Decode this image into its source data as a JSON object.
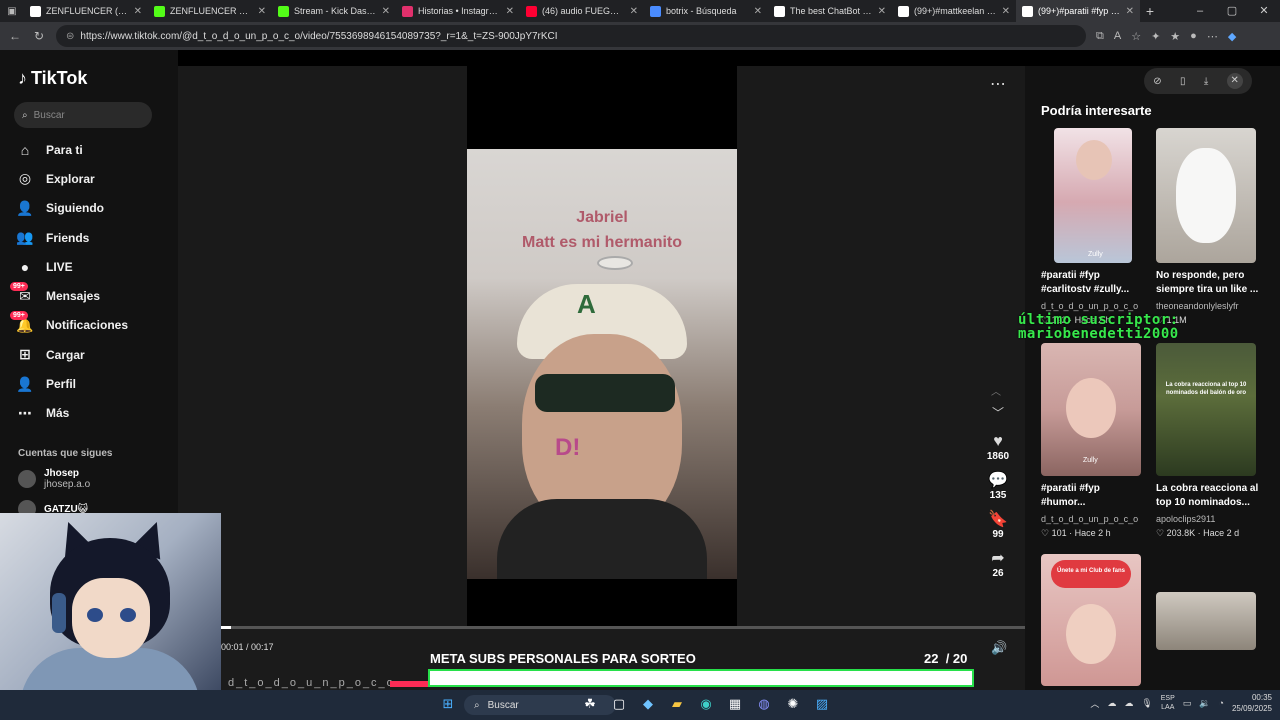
{
  "browser": {
    "tabs": [
      {
        "title": "ZENFLUENCER (@zenfl",
        "color": "#ffffff",
        "active": false
      },
      {
        "title": "ZENFLUENCER Stream",
        "color": "#53fc18",
        "active": false
      },
      {
        "title": "Stream - Kick Dashbo",
        "color": "#53fc18",
        "active": false
      },
      {
        "title": "Historias • Instagram",
        "color": "#e1306c",
        "active": false
      },
      {
        "title": "(46) audio FUEGO, FUE",
        "color": "#ff0033",
        "active": false
      },
      {
        "title": "botrix - Búsqueda",
        "color": "#4a8cff",
        "active": false
      },
      {
        "title": "The best ChatBot and V",
        "color": "#ffffff",
        "active": false
      },
      {
        "title": "(99+)#mattkeelan #ma",
        "color": "#ffffff",
        "active": false
      },
      {
        "title": "(99+)#paratii #fyp #hu",
        "color": "#ffffff",
        "active": true
      }
    ],
    "url": "https://www.tiktok.com/@d_t_o_d_o_un_p_o_c_o/video/7553698946154089735?_r=1&_t=ZS-900JpY7rKCI"
  },
  "sidebar": {
    "logo": "TikTok",
    "search_placeholder": "Buscar",
    "nav": [
      {
        "label": "Para ti",
        "icon": "home-icon",
        "glyph": "⌂"
      },
      {
        "label": "Explorar",
        "icon": "compass-icon",
        "glyph": "◎"
      },
      {
        "label": "Siguiendo",
        "icon": "following-icon",
        "glyph": "👤"
      },
      {
        "label": "Friends",
        "icon": "friends-icon",
        "glyph": "👥"
      },
      {
        "label": "LIVE",
        "icon": "live-avatar-icon",
        "glyph": "●"
      },
      {
        "label": "Mensajes",
        "icon": "messages-icon",
        "glyph": "✉",
        "badge": "99+"
      },
      {
        "label": "Notificaciones",
        "icon": "notifications-icon",
        "glyph": "🔔",
        "badge": "99+"
      },
      {
        "label": "Cargar",
        "icon": "upload-icon",
        "glyph": "⊞"
      },
      {
        "label": "Perfil",
        "icon": "profile-icon",
        "glyph": "👤"
      },
      {
        "label": "Más",
        "icon": "more-icon",
        "glyph": "⋯"
      }
    ],
    "following_header": "Cuentas que sigues",
    "following": [
      {
        "name": "Jhosep",
        "handle": "jhosep.a.o"
      },
      {
        "name": "GATZU😺",
        "handle": ""
      }
    ]
  },
  "video": {
    "caption_line1": "Jabriel",
    "caption_line2": "Matt es mi hermanito",
    "stamp": "D!",
    "likes": "1860",
    "comments": "135",
    "saves": "99",
    "shares": "26",
    "time": "00:01 / 00:17",
    "progress": 0.012,
    "author_strip": "d_t_o_d_o_u_n_p_o_c_o"
  },
  "stream_overlay": {
    "goal_label": "META SUBS PERSONALES PARA SORTEO",
    "goal_current": "22",
    "goal_total": "/ 20",
    "goal_color": "#27e04a",
    "last_sub_line1": "último suscriptor:",
    "last_sub_line2": "mariobenedetti2000"
  },
  "recommendations": {
    "header": "Podría interesarte",
    "cards": [
      {
        "title": "#paratii #fyp #carlitostv #zully...",
        "user": "d_t_o_d_o_un_p_o_c_o",
        "stats": "♡ 192 · Hace 2 h"
      },
      {
        "title": "No responde, pero siempre tira un like ...",
        "user": "theoneandonlyleslyfr",
        "stats": "♡ 1.1M"
      },
      {
        "title": "#paratii #fyp #humor...",
        "user": "d_t_o_d_o_un_p_o_c_o",
        "stats": "♡ 101 · Hace 2 h"
      },
      {
        "title": "La cobra reacciona al top 10 nominados...",
        "user": "apoloclips2911",
        "stats": "♡ 203.8K · Hace 2 d"
      }
    ],
    "thumb_text_1": "Zully",
    "thumb_text_3": "Zully",
    "thumb_text_4": "La cobra reacciona al top 10 nominados del balón de oro",
    "thumb_text_5": "Únete a mi Club de fans"
  },
  "taskbar": {
    "search": "Buscar",
    "lang": "ESP",
    "lang2": "LAA",
    "time": "00:35",
    "date": "25/09/2025"
  }
}
